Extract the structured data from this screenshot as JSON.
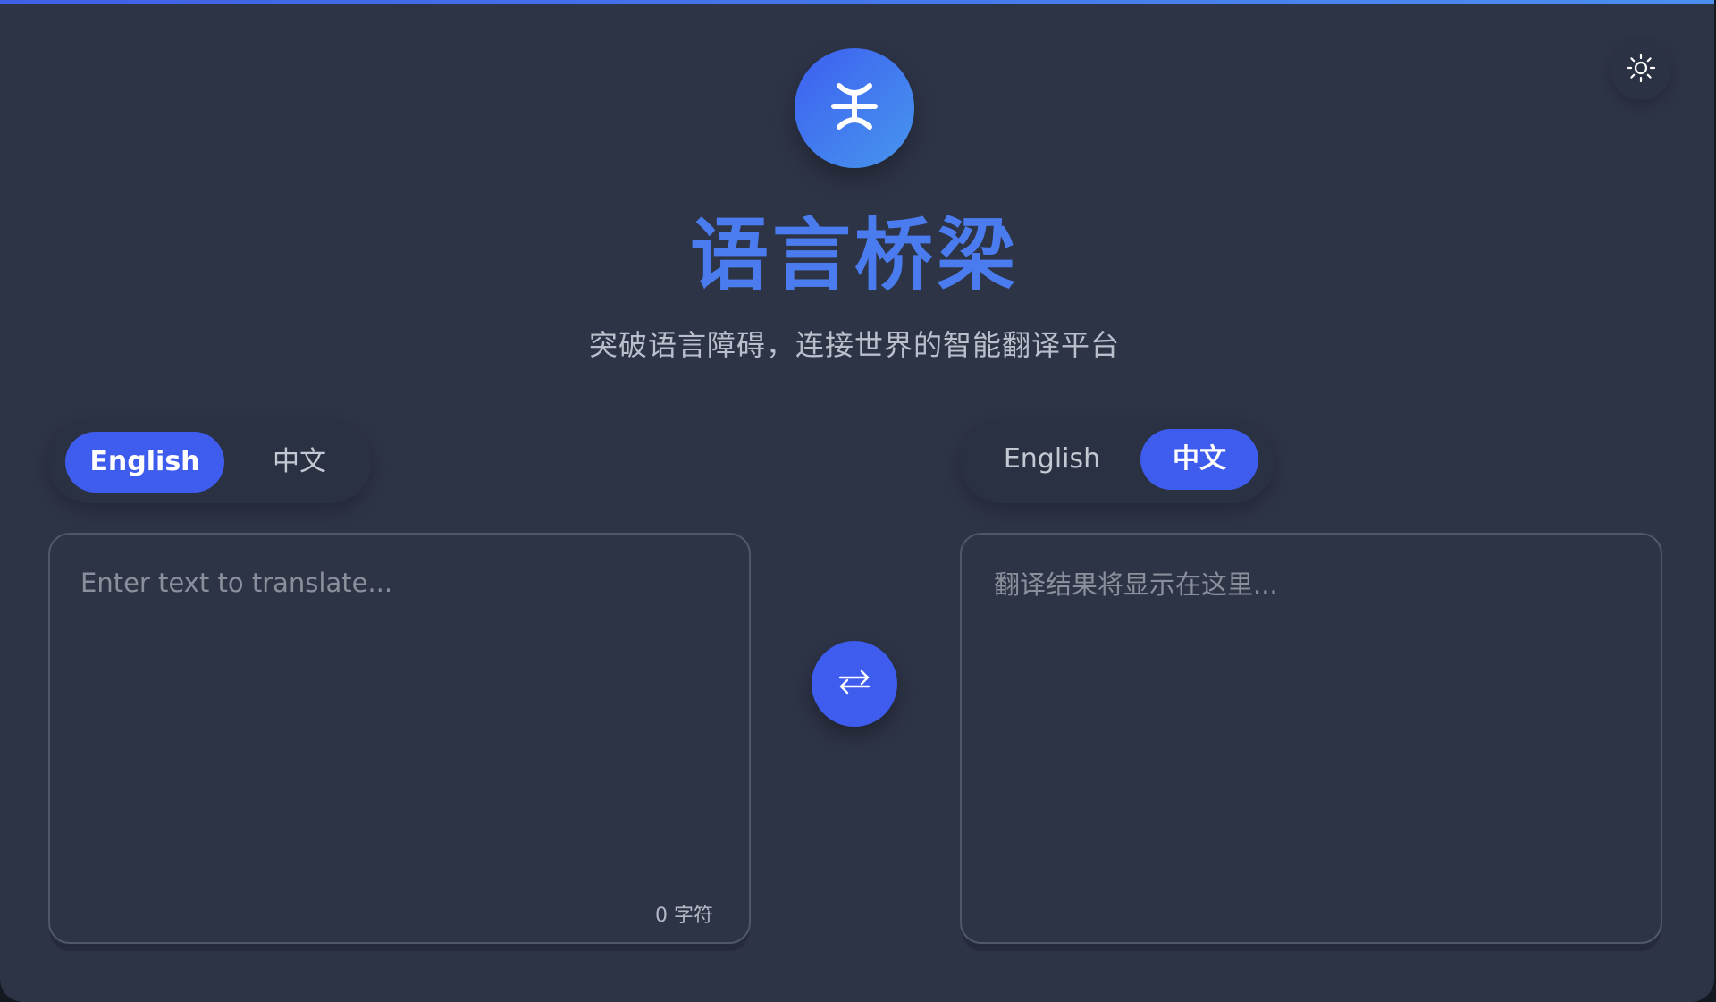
{
  "app": {
    "title": "语言桥梁",
    "subtitle": "突破语言障碍，连接世界的智能翻译平台"
  },
  "icons": {
    "logo": "translate-logo-icon",
    "theme": "sun-icon",
    "swap": "swap-arrows-icon"
  },
  "colors": {
    "accent": "#3e5ced",
    "title": "#4a7cf0",
    "background": "#2d3446"
  },
  "source": {
    "languages": [
      "English",
      "中文"
    ],
    "selected": "English",
    "placeholder": "Enter text to translate...",
    "char_count": "0 字符"
  },
  "target": {
    "languages": [
      "English",
      "中文"
    ],
    "selected": "中文",
    "placeholder": "翻译结果将显示在这里..."
  }
}
